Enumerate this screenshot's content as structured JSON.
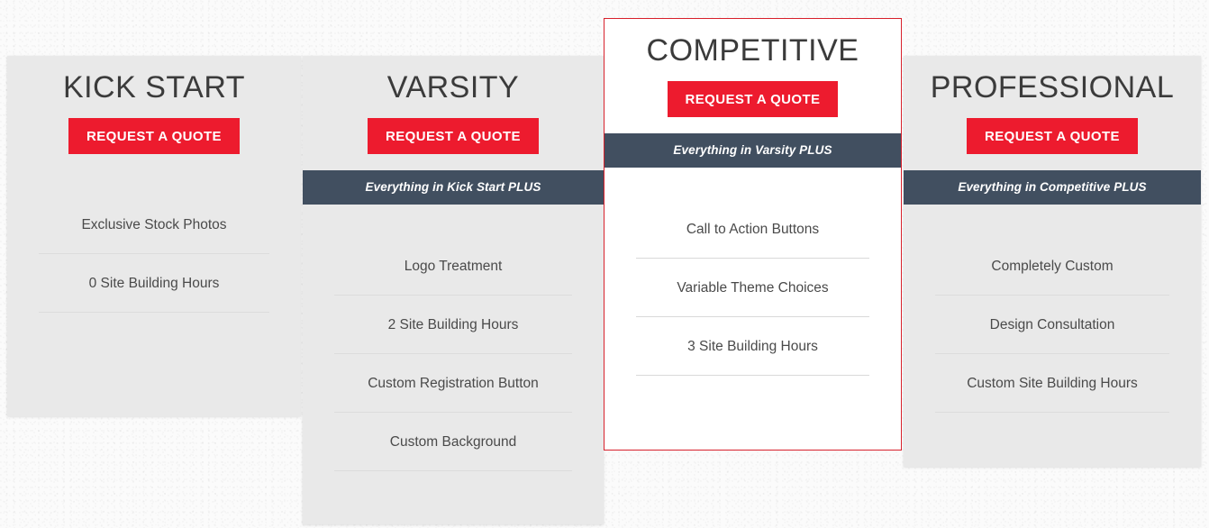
{
  "theme": {
    "accent_red": "#ED1B2E",
    "plus_bar_dark": "#414F60",
    "card_gray": "#E9E9E9",
    "card_featured": "#FFFFFF",
    "page_background": "#FBFBFB",
    "title_color": "#3B3B3B",
    "feature_text_color": "#4A4A4A"
  },
  "plans": [
    {
      "id": "kick-start",
      "title": "KICK START",
      "cta_label": "REQUEST A QUOTE",
      "plus_bar": null,
      "featured": false,
      "features": [
        "Exclusive Stock Photos",
        "0 Site Building Hours"
      ]
    },
    {
      "id": "varsity",
      "title": "VARSITY",
      "cta_label": "REQUEST A QUOTE",
      "plus_bar": "Everything in Kick Start PLUS",
      "featured": false,
      "features": [
        "Logo Treatment",
        "2 Site Building Hours",
        "Custom Registration Button",
        "Custom Background"
      ]
    },
    {
      "id": "competitive",
      "title": "COMPETITIVE",
      "cta_label": "REQUEST A QUOTE",
      "plus_bar": "Everything in Varsity PLUS",
      "featured": true,
      "features": [
        "Call to Action Buttons",
        "Variable Theme Choices",
        "3 Site Building Hours"
      ]
    },
    {
      "id": "professional",
      "title": "PROFESSIONAL",
      "cta_label": "REQUEST A QUOTE",
      "plus_bar": "Everything in Competitive PLUS",
      "featured": false,
      "features": [
        "Completely Custom",
        "Design Consultation",
        "Custom Site Building Hours"
      ]
    }
  ]
}
